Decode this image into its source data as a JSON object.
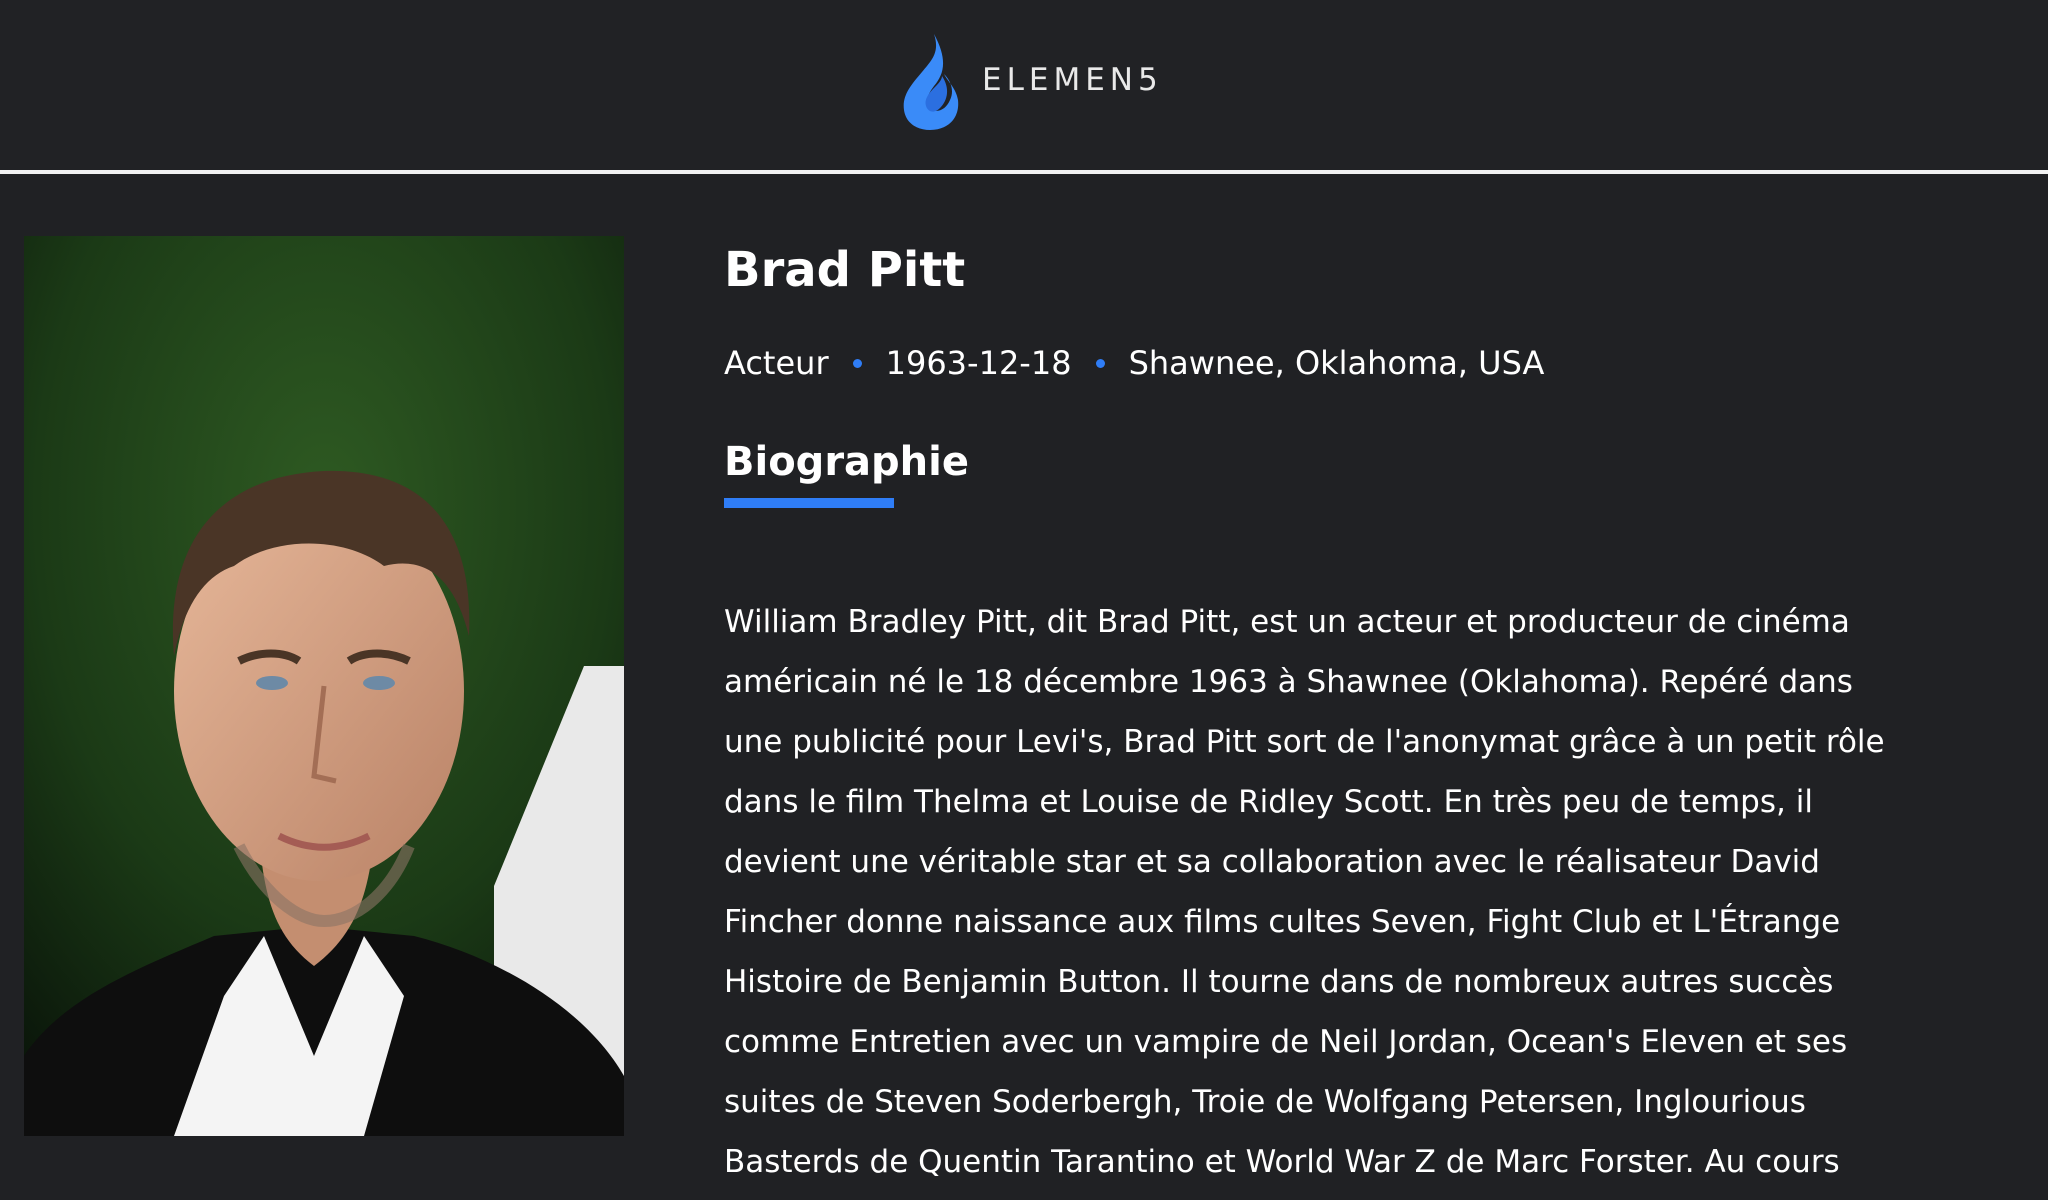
{
  "brand": {
    "name": "ELEMEN5",
    "logo_icon": "flame-icon",
    "accent": "#2f7df6"
  },
  "person": {
    "name": "Brad Pitt",
    "role": "Acteur",
    "birthdate": "1963-12-18",
    "birthplace": "Shawnee, Oklahoma, USA",
    "portrait_icon": "person-portrait"
  },
  "section": {
    "title": "Biographie"
  },
  "biography": "William Bradley Pitt, dit Brad Pitt, est un acteur et producteur de cinéma américain né le 18 décembre 1963 à Shawnee (Oklahoma). Repéré dans une publicité pour Levi's, Brad Pitt sort de l'anonymat grâce à un petit rôle dans le film Thelma et Louise de Ridley Scott. En très peu de temps, il devient une véritable star et sa collaboration avec le réalisateur David Fincher donne naissance aux films cultes Seven, Fight Club et L'Étrange Histoire de Benjamin Button. Il tourne dans de nombreux autres succès comme Entretien avec un vampire de Neil Jordan, Ocean's Eleven et ses suites de Steven Soderbergh, Troie de Wolfgang Petersen, Inglourious Basterds de Quentin Tarantino et World War Z de Marc Forster. Au cours"
}
